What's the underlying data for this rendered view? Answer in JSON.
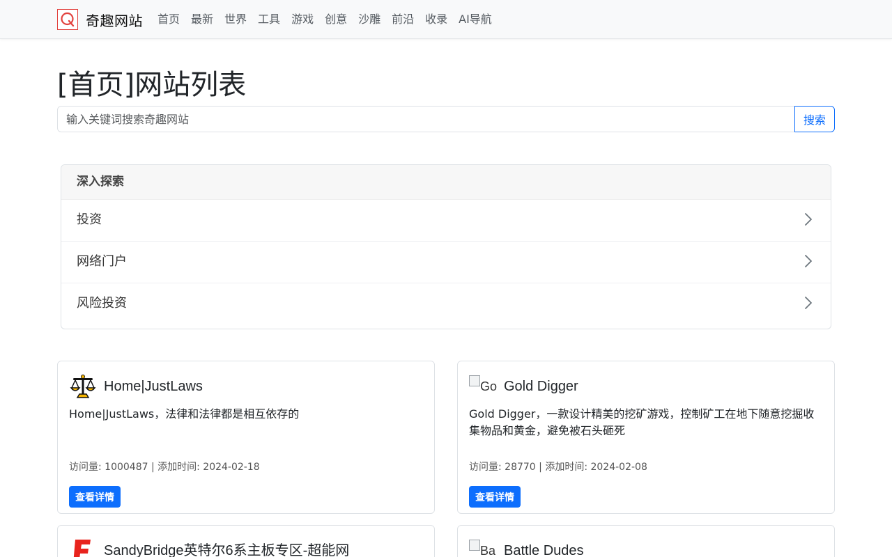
{
  "navbar": {
    "brand": "奇趣网站",
    "items": [
      "首页",
      "最新",
      "世界",
      "工具",
      "游戏",
      "创意",
      "沙雕",
      "前沿",
      "收录",
      "AI导航"
    ]
  },
  "page_title": "[首页]网站列表",
  "search": {
    "placeholder": "输入关键词搜索奇趣网站",
    "button": "搜索"
  },
  "explore": {
    "header": "深入探索",
    "items": [
      "投资",
      "网络门户",
      "风险投资"
    ]
  },
  "cards": [
    {
      "title": "Home|JustLaws",
      "icon": "scales-icon",
      "description": "Home|JustLaws，法律和法律都是相互依存的",
      "meta": "访问量: 1000487 | 添加时间: 2024-02-18",
      "button": "查看详情"
    },
    {
      "title": "Gold Digger",
      "icon_alt": "Go",
      "description": "Gold Digger，一款设计精美的挖矿游戏，控制矿工在地下随意挖掘收集物品和黄金，避免被石头砸死",
      "meta": "访问量: 28770 | 添加时间: 2024-02-08",
      "button": "查看详情"
    },
    {
      "title": "SandyBridge英特尔6系主板专区-超能网",
      "icon": "red-e-logo-icon"
    },
    {
      "title": "Battle Dudes",
      "icon_alt": "Ba"
    }
  ],
  "colors": {
    "primary": "#0d6efd",
    "brand_red": "#e2423e",
    "navbar_bg": "#f8f9fa"
  }
}
